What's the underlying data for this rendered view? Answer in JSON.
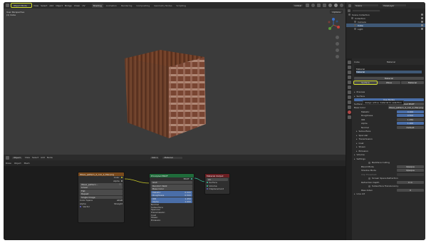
{
  "topbar": {
    "workspace_tabs": [
      {
        "label": "Shading",
        "active": true
      },
      {
        "label": "Animation",
        "active": false
      },
      {
        "label": "Rendering",
        "active": false
      },
      {
        "label": "Compositing",
        "active": false
      },
      {
        "label": "Geometry Nodes",
        "active": false
      },
      {
        "label": "Scripting",
        "active": false
      }
    ],
    "scene_label": "Scene",
    "view_layer_label": "ViewLayer"
  },
  "viewport": {
    "mode_select": "Object Mode",
    "menus": [
      "View",
      "Select",
      "Add",
      "Object",
      "Bridge",
      "Chain",
      "UV"
    ],
    "overlay_line1": "User Perspective",
    "overlay_line2": "(1) Cube",
    "shading_dropdown": "Options",
    "global_label": "Global"
  },
  "node_editor": {
    "object_select": "Object",
    "menus": [
      "View",
      "Select",
      "Add",
      "Node"
    ],
    "slot": "Slot 1",
    "material": "Material",
    "row2": [
      "Draw",
      "Object",
      "Mesh"
    ],
    "nodes": {
      "image": {
        "title": "Wave_pattern_d_cub_2_Mar.png",
        "out_color": "Color",
        "out_alpha": "Alpha",
        "image_name": "Wave_pattern...",
        "rows": [
          "Linear",
          "Flat",
          "Repeat",
          "Single Image"
        ],
        "color_space_label": "Color Space",
        "color_space": "sRGB",
        "alpha_label": "Alpha",
        "alpha": "Straight",
        "vector": "Vector"
      },
      "bsdf": {
        "title": "Principled BSDF",
        "bsdf_out": "BSDF",
        "dist": "GGX",
        "sss": "Random Walk",
        "rows": [
          {
            "label": "Base Color",
            "value": ""
          },
          {
            "label": "Metallic",
            "value": "0.000"
          },
          {
            "label": "Roughness",
            "value": "0.500"
          },
          {
            "label": "IOR",
            "value": "1.450"
          },
          {
            "label": "Alpha",
            "value": "1.000"
          }
        ],
        "sections": [
          "Normal",
          "Subsurface",
          "Specular",
          "Transmission",
          "Coat",
          "Sheen",
          "Emission"
        ]
      },
      "output": {
        "title": "Material Output",
        "target": "All",
        "sockets": [
          "Surface",
          "Volume",
          "Displacement"
        ]
      }
    }
  },
  "outliner": {
    "header": "Scene Collection",
    "items": [
      {
        "label": "Scene Collection",
        "selected": false,
        "indent": 0
      },
      {
        "label": "Collection",
        "selected": false,
        "indent": 1
      },
      {
        "label": "Camera",
        "selected": false,
        "indent": 2
      },
      {
        "label": "Cube",
        "selected": true,
        "indent": 2
      },
      {
        "label": "Light",
        "selected": false,
        "indent": 2
      }
    ]
  },
  "properties": {
    "object_name": "Cube",
    "slot_name": "Material",
    "material_name": "Material",
    "material_buttons": [
      "Surface",
      "Wave",
      "Material"
    ],
    "tooltip": "Assign active material to selection",
    "preview_label": "Preview",
    "surface_section": "Surface",
    "use_nodes": "Use Nodes",
    "surface_label": "Surface",
    "surface_value": "Principled BSDF",
    "base_color_label": "Base Color",
    "base_color_value": "Wave_pattern_d_cub_2_Mar.png",
    "fields": [
      {
        "label": "Metallic",
        "value": "0.000",
        "blue": true
      },
      {
        "label": "Roughness",
        "value": "0.500",
        "blue": true
      },
      {
        "label": "IOR",
        "value": "1.450",
        "blue": false
      },
      {
        "label": "Alpha",
        "value": "1.000",
        "blue": true
      },
      {
        "label": "Normal",
        "value": "Default",
        "blue": false
      }
    ],
    "sections": [
      "Subsurface",
      "Specular",
      "Transmission",
      "Coat",
      "Sheen",
      "Emission"
    ],
    "volume_section": "Volume",
    "settings_section": "Settings",
    "backface_culling": "Backface Culling",
    "blend_mode_label": "Blend Mode",
    "blend_mode": "Opaque",
    "shadow_mode_label": "Shadow Mode",
    "shadow_mode": "Opaque",
    "clip_threshold": "Clip Threshold",
    "screen_space_refraction": "Screen Space Refraction",
    "refraction_depth_label": "Refraction Depth",
    "refraction_depth": "0 m",
    "subsurface_translucency": "Subsurface Translucency",
    "pass_index_label": "Pass Index",
    "pass_index": "0",
    "line_art": "Line Art"
  },
  "colors": {
    "highlight": "#d4e030",
    "selection": "#3f5876",
    "field_blue": "#4a6ea8",
    "image_node_header": "#7a4a1c",
    "bsdf_node_header": "#1f6b3a",
    "output_node_header": "#6a1e22",
    "socket_yellow": "#c7c729",
    "socket_gray": "#a1a1a1",
    "socket_purple": "#6363c7",
    "socket_green": "#3ac7a0"
  }
}
